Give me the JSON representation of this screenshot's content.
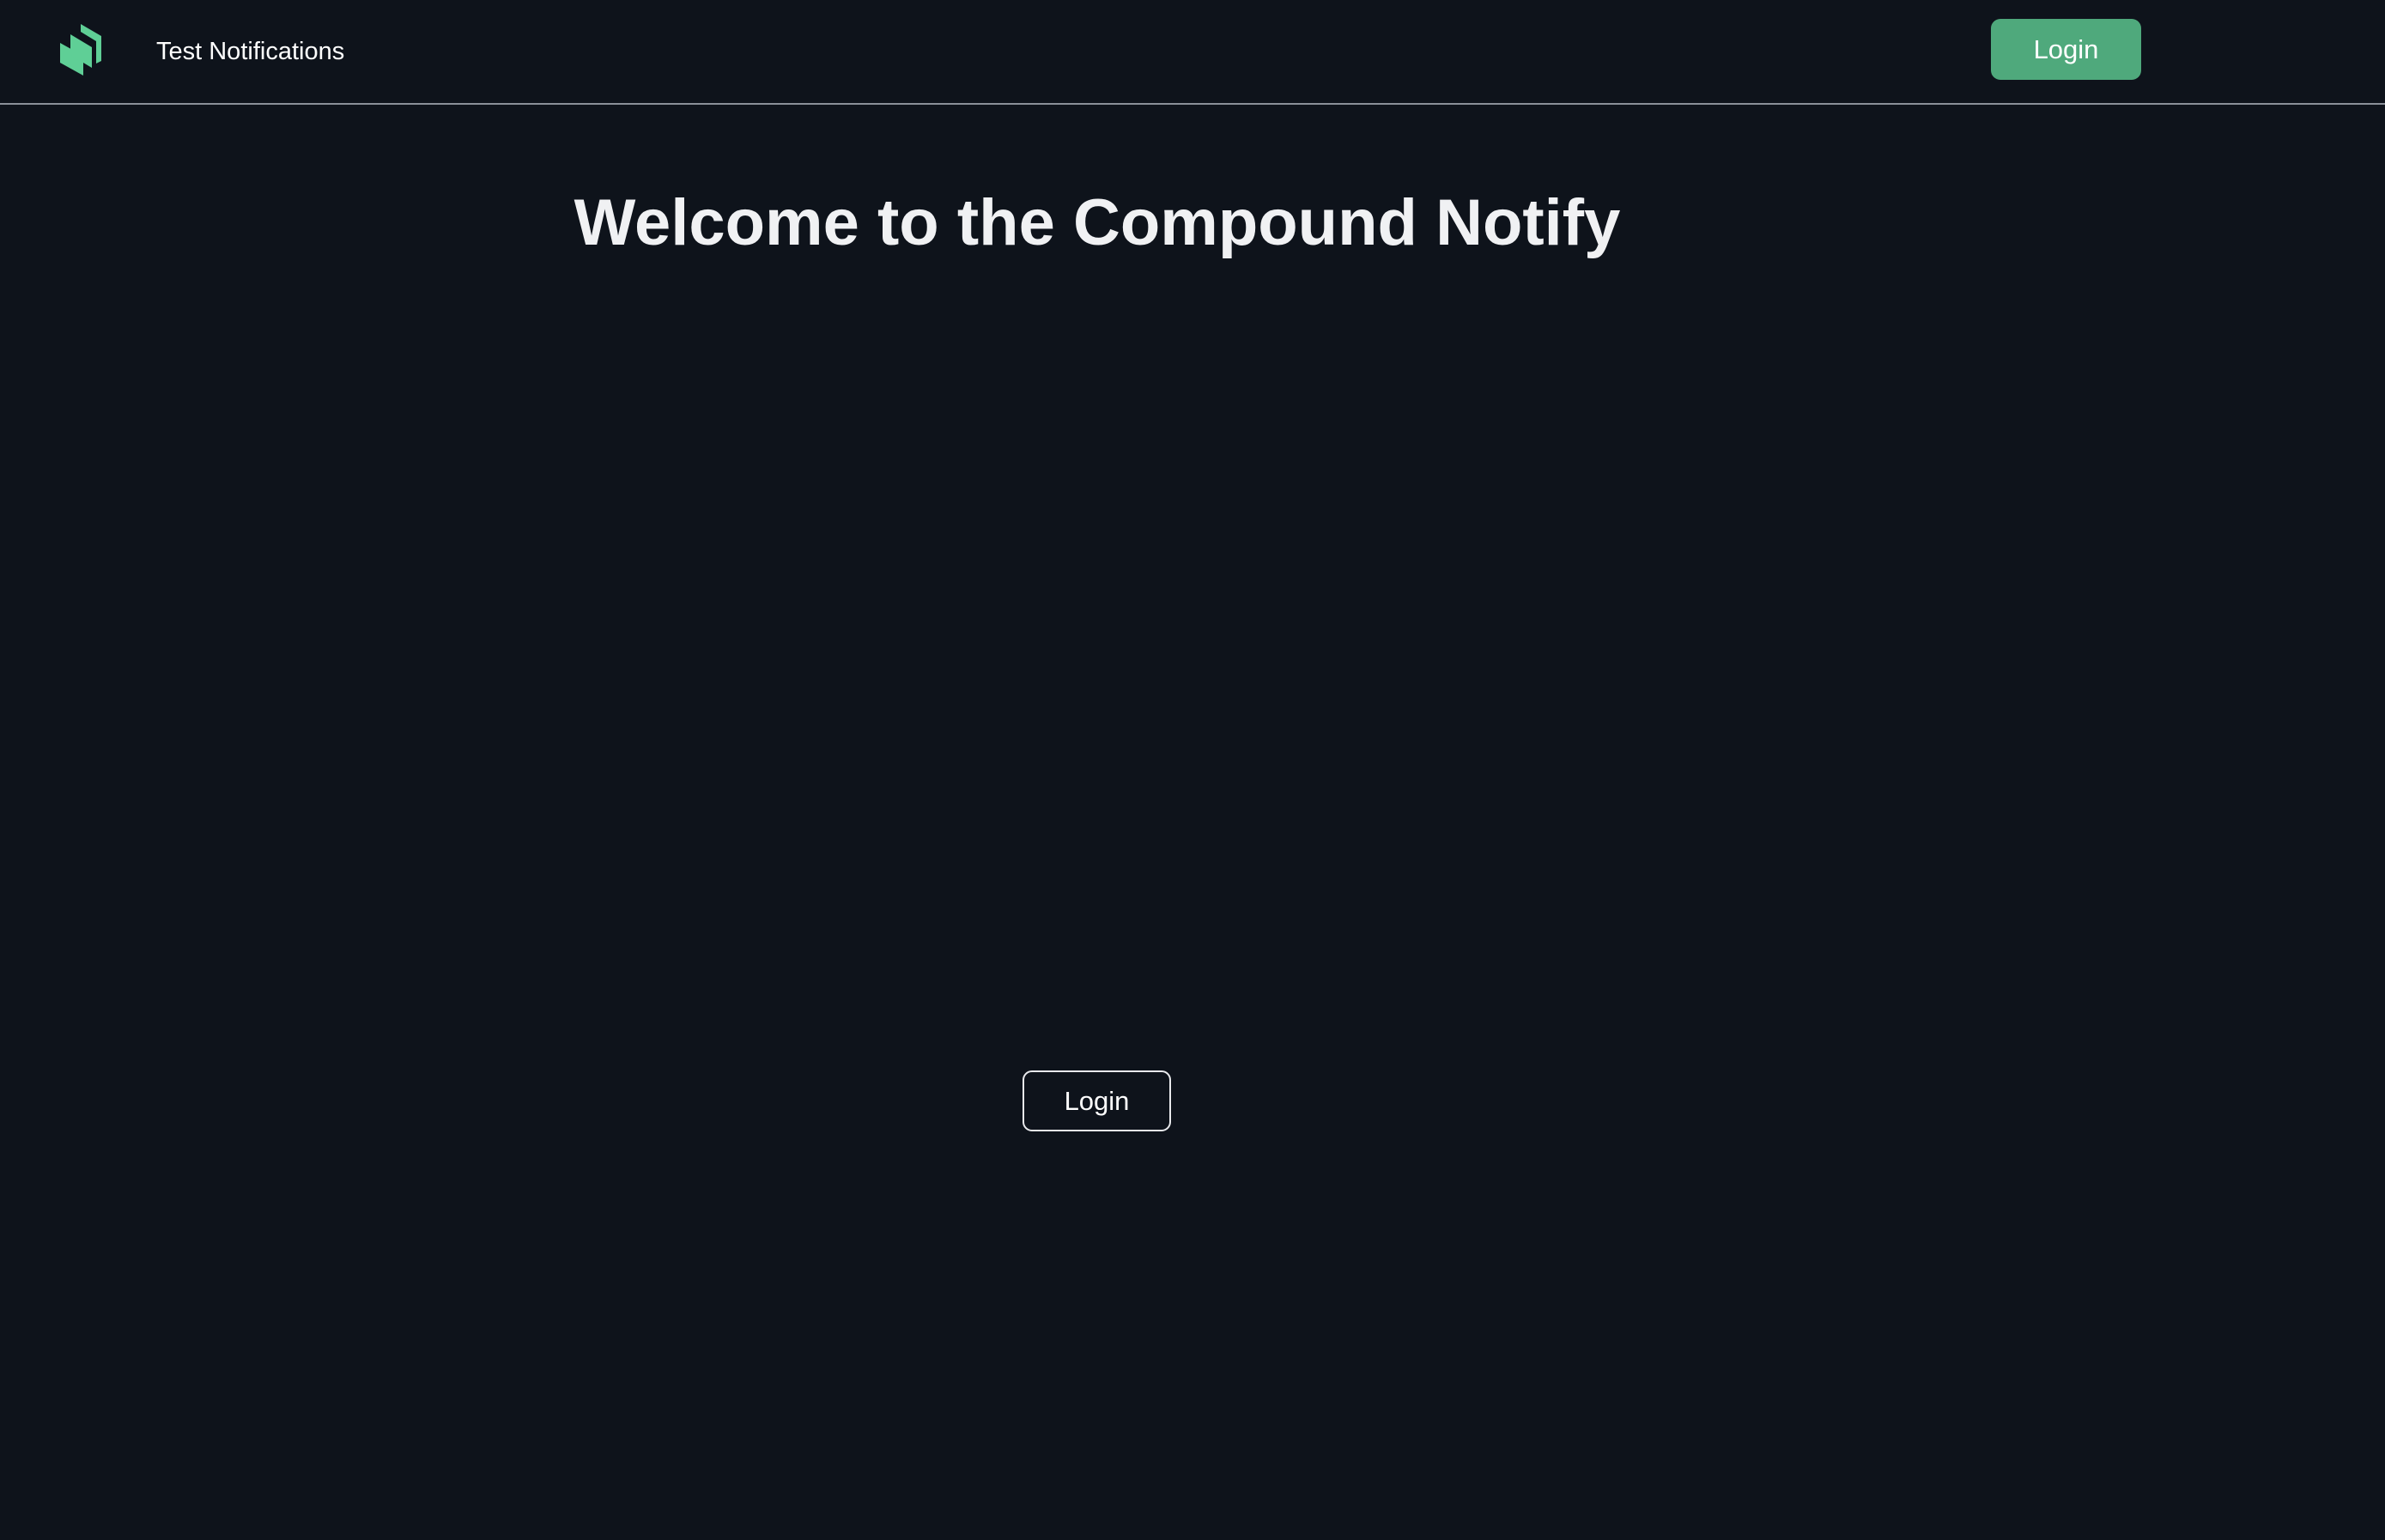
{
  "navbar": {
    "logo_icon": "compound-logo-icon",
    "link_label": "Test Notifications",
    "login_label": "Login"
  },
  "main": {
    "title": "Welcome to the Compound Notify",
    "login_label": "Login"
  },
  "colors": {
    "background": "#0e131b",
    "accent": "#4fa97c",
    "logo": "#5fcf96",
    "divider": "#8a9099"
  }
}
